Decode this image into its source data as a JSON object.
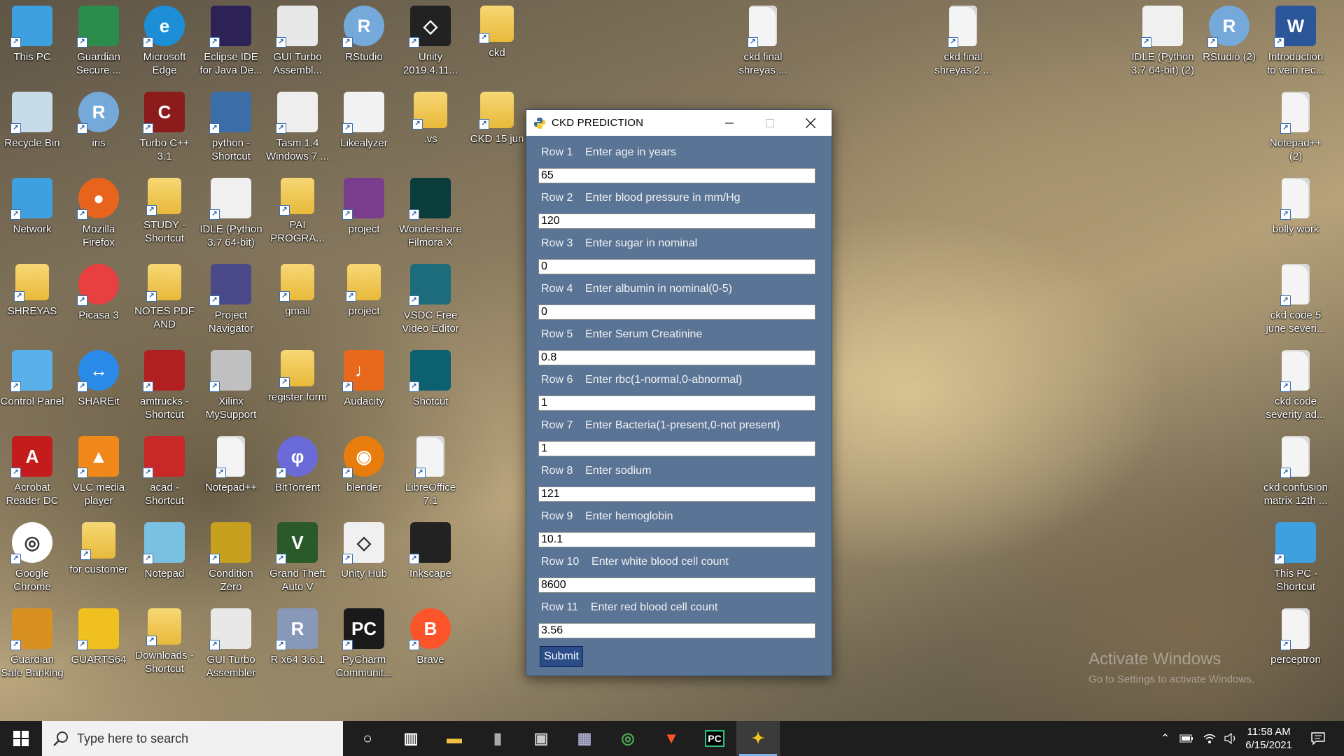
{
  "desktop": {
    "left_icons": [
      {
        "label": "This PC",
        "icon": "this-pc-icon"
      },
      {
        "label": "Guardian\nSecure ...",
        "icon": "globe-shield-icon"
      },
      {
        "label": "Microsoft\nEdge",
        "icon": "edge-icon"
      },
      {
        "label": "Eclipse IDE\nfor Java De...",
        "icon": "eclipse-icon"
      },
      {
        "label": "GUI Turbo\nAssembl...",
        "icon": "gui-turbo-icon"
      },
      {
        "label": "RStudio",
        "icon": "rstudio-icon"
      },
      {
        "label": "Unity\n2019.4.11...",
        "icon": "unity-icon"
      },
      {
        "label": "ckd",
        "icon": "folder-icon"
      },
      {
        "label": "Recycle Bin",
        "icon": "recycle-bin-icon"
      },
      {
        "label": "iris",
        "icon": "r-icon"
      },
      {
        "label": "Turbo C++\n3.1",
        "icon": "turbo-cpp-icon"
      },
      {
        "label": "python -\nShortcut",
        "icon": "python-icon"
      },
      {
        "label": "Tasm 1.4\nWindows 7 ...",
        "icon": "tasm-icon"
      },
      {
        "label": "Likealyzer",
        "icon": "powerpoint-icon"
      },
      {
        "label": ".vs",
        "icon": "folder-icon"
      },
      {
        "label": "CKD 15 jun",
        "icon": "folder-icon"
      },
      {
        "label": "Network",
        "icon": "network-icon"
      },
      {
        "label": "Mozilla\nFirefox",
        "icon": "firefox-icon"
      },
      {
        "label": "STUDY -\nShortcut",
        "icon": "folder-icon"
      },
      {
        "label": "IDLE (Python\n3.7 64-bit)",
        "icon": "idle-icon"
      },
      {
        "label": "PAI\nPROGRA...",
        "icon": "folder-icon"
      },
      {
        "label": "project",
        "icon": "winrar-icon"
      },
      {
        "label": "Wondershare\nFilmora X",
        "icon": "filmora-icon"
      },
      {
        "label": "SHREYAS",
        "icon": "user-folder-icon"
      },
      {
        "label": "Picasa 3",
        "icon": "picasa-icon"
      },
      {
        "label": "NOTES PDF\nAND TEXTS...",
        "icon": "folder-icon"
      },
      {
        "label": "Project\nNavigator",
        "icon": "project-navigator-icon"
      },
      {
        "label": "gmail",
        "icon": "folder-icon"
      },
      {
        "label": "project",
        "icon": "folder-icon"
      },
      {
        "label": "VSDC Free\nVideo Editor",
        "icon": "vsdc-icon"
      },
      {
        "label": "Control Panel",
        "icon": "control-panel-icon"
      },
      {
        "label": "SHAREit",
        "icon": "shareit-icon"
      },
      {
        "label": "amtrucks -\nShortcut",
        "icon": "truck-icon"
      },
      {
        "label": "Xilinx\nMySupport",
        "icon": "xilinx-icon"
      },
      {
        "label": "register form",
        "icon": "chrome-folder-icon"
      },
      {
        "label": "Audacity",
        "icon": "audacity-icon"
      },
      {
        "label": "Shotcut",
        "icon": "shotcut-icon"
      },
      {
        "label": "Acrobat\nReader DC",
        "icon": "acrobat-icon"
      },
      {
        "label": "VLC media\nplayer",
        "icon": "vlc-icon"
      },
      {
        "label": "acad -\nShortcut",
        "icon": "autocad-icon"
      },
      {
        "label": "Notepad++",
        "icon": "file-icon"
      },
      {
        "label": "BitTorrent",
        "icon": "bittorrent-icon"
      },
      {
        "label": "blender",
        "icon": "blender-icon"
      },
      {
        "label": "LibreOffice\n7.1",
        "icon": "file-icon"
      },
      {
        "label": "Google\nChrome",
        "icon": "chrome-icon"
      },
      {
        "label": "for customer",
        "icon": "folder-icon"
      },
      {
        "label": "Notepad",
        "icon": "notepad-icon"
      },
      {
        "label": "Condition\nZero",
        "icon": "counter-strike-icon"
      },
      {
        "label": "Grand Theft\nAuto V",
        "icon": "gta-icon"
      },
      {
        "label": "Unity Hub",
        "icon": "unity-hub-icon"
      },
      {
        "label": "Inkscape",
        "icon": "inkscape-icon"
      },
      {
        "label": "Guardian\nSafe Banking",
        "icon": "banking-icon"
      },
      {
        "label": "GUARTS64",
        "icon": "guarts-icon"
      },
      {
        "label": "Downloads -\nShortcut",
        "icon": "downloads-folder-icon"
      },
      {
        "label": "GUI Turbo\nAssembler",
        "icon": "gui-turbo-icon"
      },
      {
        "label": "R x64 3.6.1",
        "icon": "r-x64-icon"
      },
      {
        "label": "PyCharm\nCommunit...",
        "icon": "pycharm-icon"
      },
      {
        "label": "Brave",
        "icon": "brave-icon"
      }
    ],
    "top_icons": [
      {
        "label": "ckd final\nshreyas ...",
        "icon": "file-icon"
      },
      {
        "label": "ckd final\nshreyas 2 ...",
        "icon": "file-icon"
      }
    ],
    "right_icons": [
      {
        "label": "IDLE (Python\n3.7 64-bit) (2)",
        "icon": "idle-icon"
      },
      {
        "label": "RStudio (2)",
        "icon": "rstudio-icon"
      },
      {
        "label": "Introduction\nto vein rec...",
        "icon": "word-icon"
      },
      {
        "label": "Notepad++\n(2)",
        "icon": "file-icon"
      },
      {
        "label": "bolly work",
        "icon": "word-file-icon"
      },
      {
        "label": "ckd code 5\njune severi...",
        "icon": "file-icon"
      },
      {
        "label": "ckd code\nseverity ad...",
        "icon": "file-icon"
      },
      {
        "label": "ckd confusion\nmatrix 12th ...",
        "icon": "file-icon"
      },
      {
        "label": "This PC -\nShortcut",
        "icon": "this-pc-icon"
      },
      {
        "label": "perceptron",
        "icon": "file-icon"
      }
    ]
  },
  "window": {
    "title": "CKD PREDICTION",
    "icon": "python-feather-icon",
    "rows": [
      {
        "label": "Row 1    Enter age in years",
        "value": "65"
      },
      {
        "label": "Row 2    Enter blood pressure in mm/Hg",
        "value": "120"
      },
      {
        "label": "Row 3    Enter sugar in nominal",
        "value": "0"
      },
      {
        "label": "Row 4    Enter albumin in nominal(0-5)",
        "value": "0"
      },
      {
        "label": "Row 5    Enter Serum Creatinine",
        "value": "0.8"
      },
      {
        "label": "Row 6    Enter rbc(1-normal,0-abnormal)",
        "value": "1"
      },
      {
        "label": "Row 7    Enter Bacteria(1-present,0-not present)",
        "value": "1"
      },
      {
        "label": "Row 8    Enter sodium",
        "value": "121"
      },
      {
        "label": "Row 9    Enter hemoglobin",
        "value": "10.1"
      },
      {
        "label": "Row 10    Enter white blood cell count",
        "value": "8600"
      },
      {
        "label": "Row 11    Enter red blood cell count",
        "value": "3.56"
      }
    ],
    "submit_label": "Submit",
    "bg_color": "#5a7495",
    "button_color": "#2a4d8a"
  },
  "watermark": {
    "line1": "Activate Windows",
    "line2": "Go to Settings to activate Windows."
  },
  "taskbar": {
    "search_placeholder": "Type here to search",
    "apps": [
      "cortana-icon",
      "task-view-icon",
      "file-explorer-icon",
      "usb-device-icon",
      "app-icon",
      "calculator-icon",
      "chrome-icon",
      "brave-icon",
      "pycharm-icon",
      "python-icon"
    ],
    "time": "11:58 AM",
    "date": "6/15/2021"
  }
}
